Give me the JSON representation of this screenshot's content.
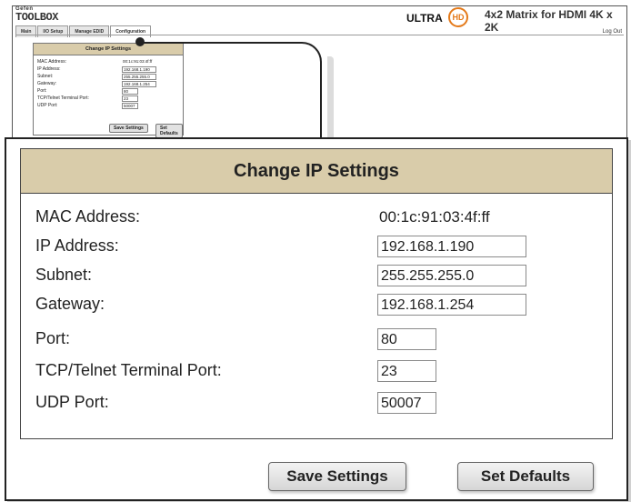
{
  "mini": {
    "brand_top": "Gefen",
    "brand": "TOOLBOX",
    "tabs": [
      "Main",
      "I/O Setup",
      "Manage EDID",
      "Configuration"
    ],
    "ultra": "ULTRA",
    "hd": "HD",
    "product": "4x2 Matrix for HDMI 4K x 2K",
    "logout": "Log Out"
  },
  "panel": {
    "title": "Change IP Settings",
    "rows": [
      {
        "label": "MAC Address:",
        "value": "00:1c:91:03:4f:ff"
      },
      {
        "label": "IP Address:",
        "value": "192.168.1.190"
      },
      {
        "label": "Subnet:",
        "value": "255.255.255.0"
      },
      {
        "label": "Gateway:",
        "value": "192.168.1.254"
      },
      {
        "label": "Port:",
        "value": "80"
      },
      {
        "label": "TCP/Telnet Terminal Port:",
        "value": "23"
      },
      {
        "label": "UDP Port:",
        "value": "50007"
      }
    ]
  },
  "buttons": {
    "save": "Save Settings",
    "defaults": "Set Defaults"
  },
  "colors": {
    "header_bg": "#d9ccaa",
    "hd_accent": "#e47a1a"
  }
}
